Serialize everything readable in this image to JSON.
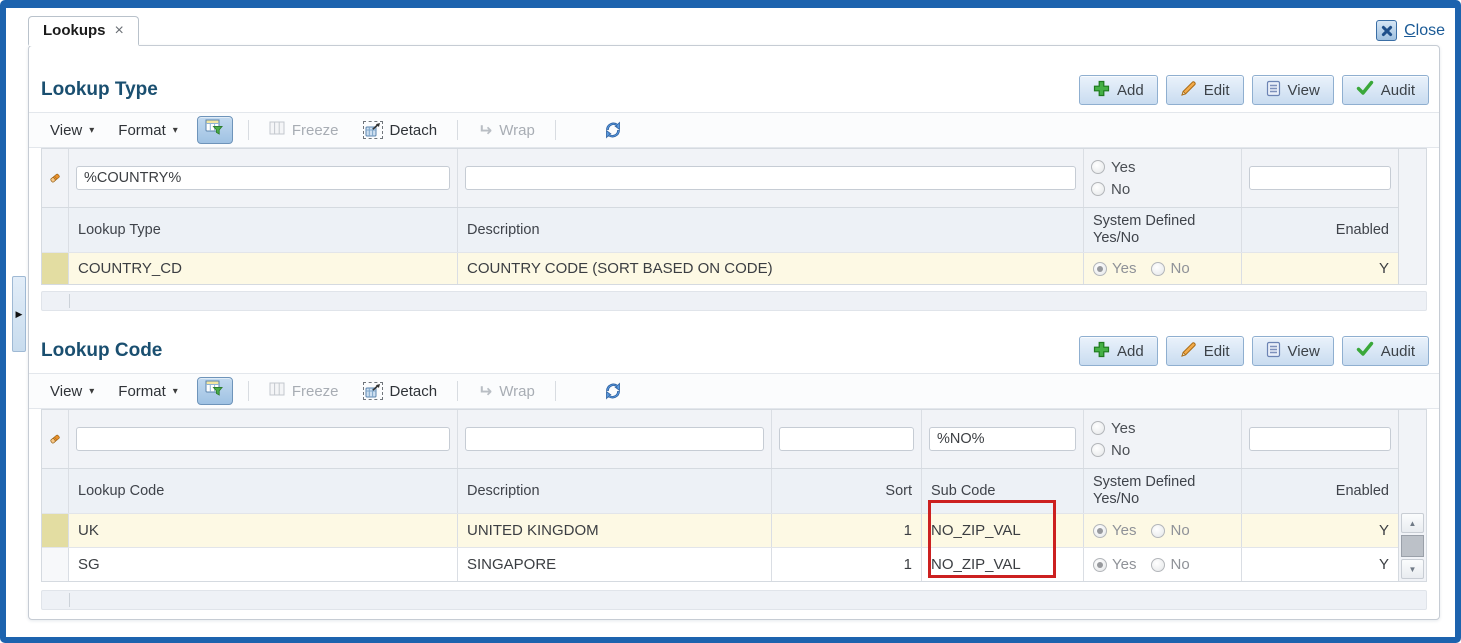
{
  "icons": {
    "tab_close": "×",
    "caret_down": "▾",
    "wrap_arrow": "↵",
    "scroll_up": "▲",
    "scroll_down": "▼",
    "splitter_arrow": "▶"
  },
  "colors": {
    "frame_blue": "#1d63ae",
    "section_title": "#1a4f70",
    "selected_row_bg": "#fdf9e4",
    "highlight_red": "#cc2020",
    "button_border": "#8fafd0"
  },
  "tab": {
    "label": "Lookups"
  },
  "close_button": {
    "label": "Close"
  },
  "lookup_type": {
    "title": "Lookup Type",
    "actions": {
      "add": "Add",
      "edit": "Edit",
      "view": "View",
      "audit": "Audit"
    },
    "toolbar": {
      "view": "View",
      "format": "Format",
      "freeze": "Freeze",
      "detach": "Detach",
      "wrap": "Wrap"
    },
    "filter": {
      "lookup_type": "%COUNTRY%",
      "description": "",
      "yes": "Yes",
      "no": "No",
      "enabled": ""
    },
    "columns": {
      "lookup_type": "Lookup Type",
      "description": "Description",
      "system_defined_1": "System Defined",
      "system_defined_2": "Yes/No",
      "enabled": "Enabled"
    },
    "rows": [
      {
        "lookup_type": "COUNTRY_CD",
        "description": "COUNTRY CODE (SORT BASED ON CODE)",
        "yes": "Yes",
        "no": "No",
        "system_defined": "Yes",
        "enabled": "Y"
      }
    ]
  },
  "lookup_code": {
    "title": "Lookup Code",
    "actions": {
      "add": "Add",
      "edit": "Edit",
      "view": "View",
      "audit": "Audit"
    },
    "toolbar": {
      "view": "View",
      "format": "Format",
      "freeze": "Freeze",
      "detach": "Detach",
      "wrap": "Wrap"
    },
    "filter": {
      "lookup_code": "",
      "description": "",
      "sort": "",
      "sub_code": "%NO%",
      "yes": "Yes",
      "no": "No",
      "enabled": ""
    },
    "columns": {
      "lookup_code": "Lookup Code",
      "description": "Description",
      "sort": "Sort",
      "sub_code": "Sub Code",
      "system_defined_1": "System Defined",
      "system_defined_2": "Yes/No",
      "enabled": "Enabled"
    },
    "rows": [
      {
        "lookup_code": "UK",
        "description": "UNITED KINGDOM",
        "sort": "1",
        "sub_code": "NO_ZIP_VAL",
        "yes": "Yes",
        "no": "No",
        "system_defined": "Yes",
        "enabled": "Y"
      },
      {
        "lookup_code": "SG",
        "description": "SINGAPORE",
        "sort": "1",
        "sub_code": "NO_ZIP_VAL",
        "yes": "Yes",
        "no": "No",
        "system_defined": "Yes",
        "enabled": "Y"
      }
    ]
  }
}
